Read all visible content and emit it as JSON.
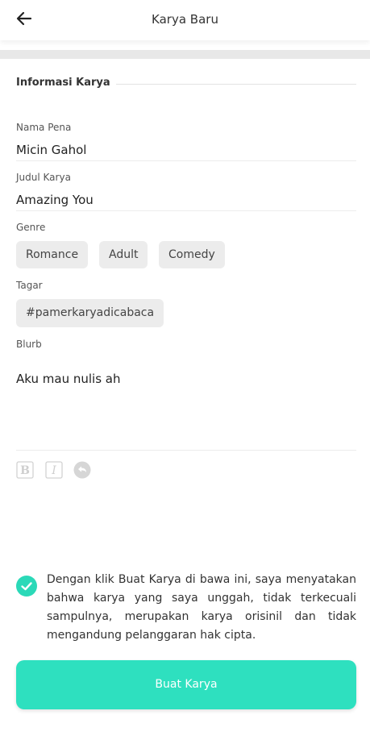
{
  "header": {
    "title": "Karya Baru"
  },
  "section": {
    "title": "Informasi Karya"
  },
  "fields": {
    "pen_name": {
      "label": "Nama Pena",
      "value": "Micin Gahol"
    },
    "title": {
      "label": "Judul Karya",
      "value": "Amazing You"
    },
    "genre": {
      "label": "Genre",
      "options": [
        "Romance",
        "Adult",
        "Comedy"
      ]
    },
    "tags": {
      "label": "Tagar",
      "items": [
        "#pamerkaryadicabaca"
      ]
    },
    "blurb": {
      "label": "Blurb",
      "value": "Aku mau nulis ah"
    }
  },
  "editor_tools": [
    "bold-icon",
    "italic-icon",
    "undo-icon"
  ],
  "consent": {
    "checked": true,
    "text": "Dengan klik Buat Karya di bawa ini, saya menyatakan bahwa karya yang saya unggah, tidak terkecuali sampulnya, merupakan karya orisinil dan tidak mengandung pelanggaran hak cipta."
  },
  "submit": {
    "label": "Buat Karya"
  },
  "colors": {
    "accent": "#2ee0bf",
    "check": "#2bd9b8",
    "chip_bg": "#ececec"
  }
}
